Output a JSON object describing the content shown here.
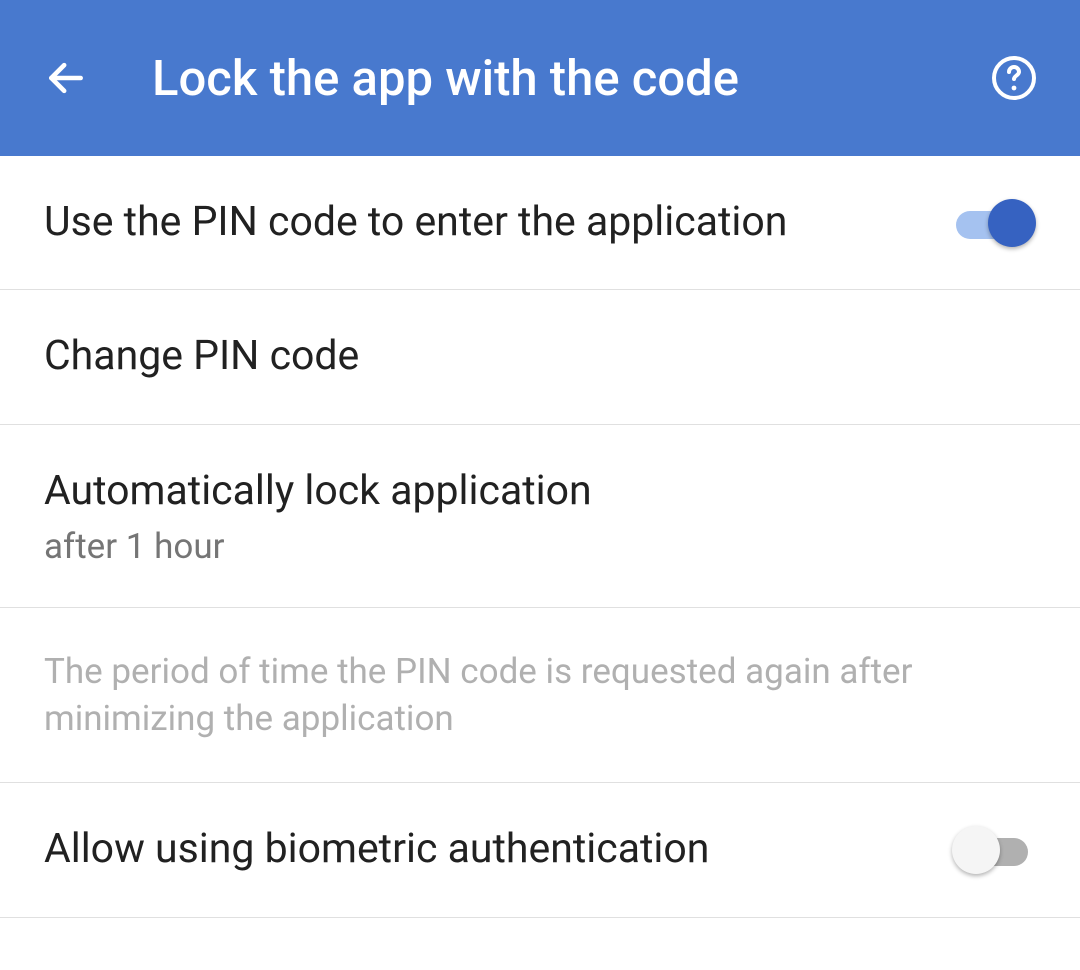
{
  "header": {
    "title": "Lock the app with the code"
  },
  "rows": {
    "use_pin": {
      "title": "Use the PIN code to enter the application",
      "toggle_on": true
    },
    "change_pin": {
      "title": "Change PIN code"
    },
    "auto_lock": {
      "title": "Automatically lock application",
      "subtitle": "after 1 hour"
    },
    "description": "The period of time the PIN code is requested again after minimizing the application",
    "biometric": {
      "title": "Allow using biometric authentication",
      "toggle_on": false
    }
  }
}
